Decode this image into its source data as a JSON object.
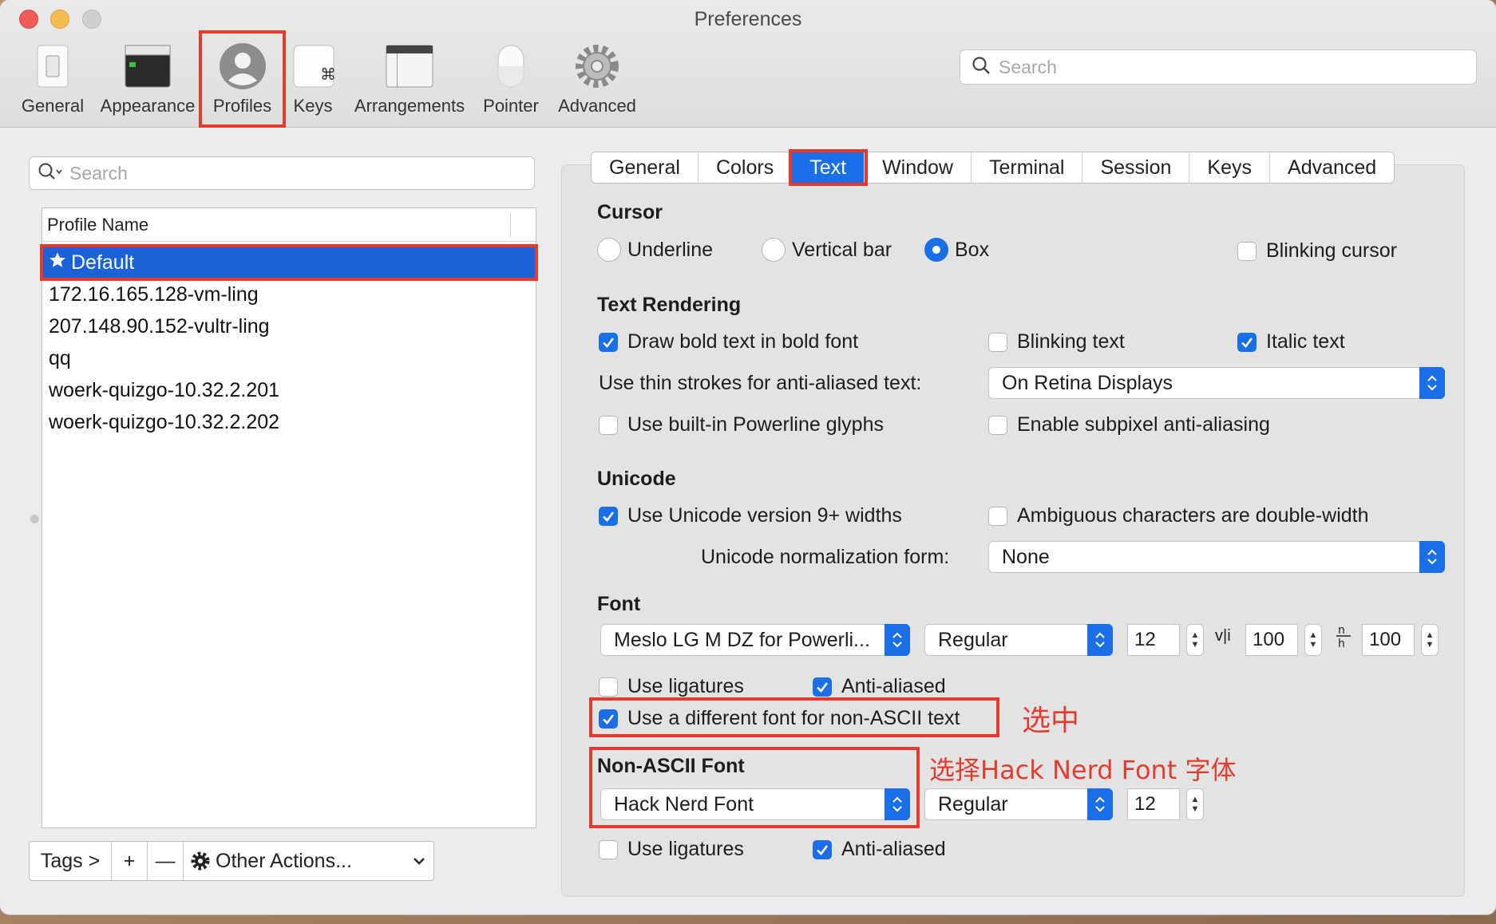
{
  "window": {
    "title": "Preferences"
  },
  "toolbar": {
    "items": [
      {
        "label": "General",
        "icon": "switch-icon"
      },
      {
        "label": "Appearance",
        "icon": "terminal-window-icon"
      },
      {
        "label": "Profiles",
        "icon": "user-profile-icon"
      },
      {
        "label": "Keys",
        "icon": "command-key-icon"
      },
      {
        "label": "Arrangements",
        "icon": "window-arrangement-icon"
      },
      {
        "label": "Pointer",
        "icon": "mouse-icon"
      },
      {
        "label": "Advanced",
        "icon": "gear-icon"
      }
    ],
    "search_placeholder": "Search"
  },
  "profiles": {
    "search_placeholder": "Search",
    "column_header": "Profile Name",
    "items": [
      "Default",
      "172.16.165.128-vm-ling",
      "207.148.90.152-vultr-ling",
      "qq",
      "woerk-quizgo-10.32.2.201",
      "woerk-quizgo-10.32.2.202"
    ],
    "bottom": {
      "tags": "Tags >",
      "add": "+",
      "remove": "—",
      "other_actions": "Other Actions..."
    }
  },
  "tabs": [
    "General",
    "Colors",
    "Text",
    "Window",
    "Terminal",
    "Session",
    "Keys",
    "Advanced"
  ],
  "text_settings": {
    "cursor": {
      "title": "Cursor",
      "underline": "Underline",
      "vertical_bar": "Vertical bar",
      "box": "Box",
      "blinking": "Blinking cursor"
    },
    "rendering": {
      "title": "Text Rendering",
      "bold": "Draw bold text in bold font",
      "blinking_text": "Blinking text",
      "italic": "Italic text",
      "thin_strokes_label": "Use thin strokes for anti-aliased text:",
      "thin_strokes_value": "On Retina Displays",
      "powerline": "Use built-in Powerline glyphs",
      "subpixel": "Enable subpixel anti-aliasing"
    },
    "unicode": {
      "title": "Unicode",
      "widths": "Use Unicode version 9+ widths",
      "ambiguous": "Ambiguous characters are double-width",
      "normalization_label": "Unicode normalization form:",
      "normalization_value": "None"
    },
    "font": {
      "title": "Font",
      "family": "Meslo LG M DZ for Powerli...",
      "style": "Regular",
      "size": "12",
      "h_spacing": "100",
      "v_spacing": "100",
      "ligatures": "Use ligatures",
      "antialiased": "Anti-aliased",
      "different_font": "Use a different font for non-ASCII text"
    },
    "non_ascii": {
      "title": "Non-ASCII Font",
      "family": "Hack Nerd Font",
      "style": "Regular",
      "size": "12",
      "ligatures": "Use ligatures",
      "antialiased": "Anti-aliased"
    }
  },
  "annotations": {
    "select": "选中",
    "choose_font": "选择Hack Nerd Font 字体"
  },
  "colors": {
    "accent": "#1a6fe8",
    "highlight_red": "#e53b2f"
  }
}
